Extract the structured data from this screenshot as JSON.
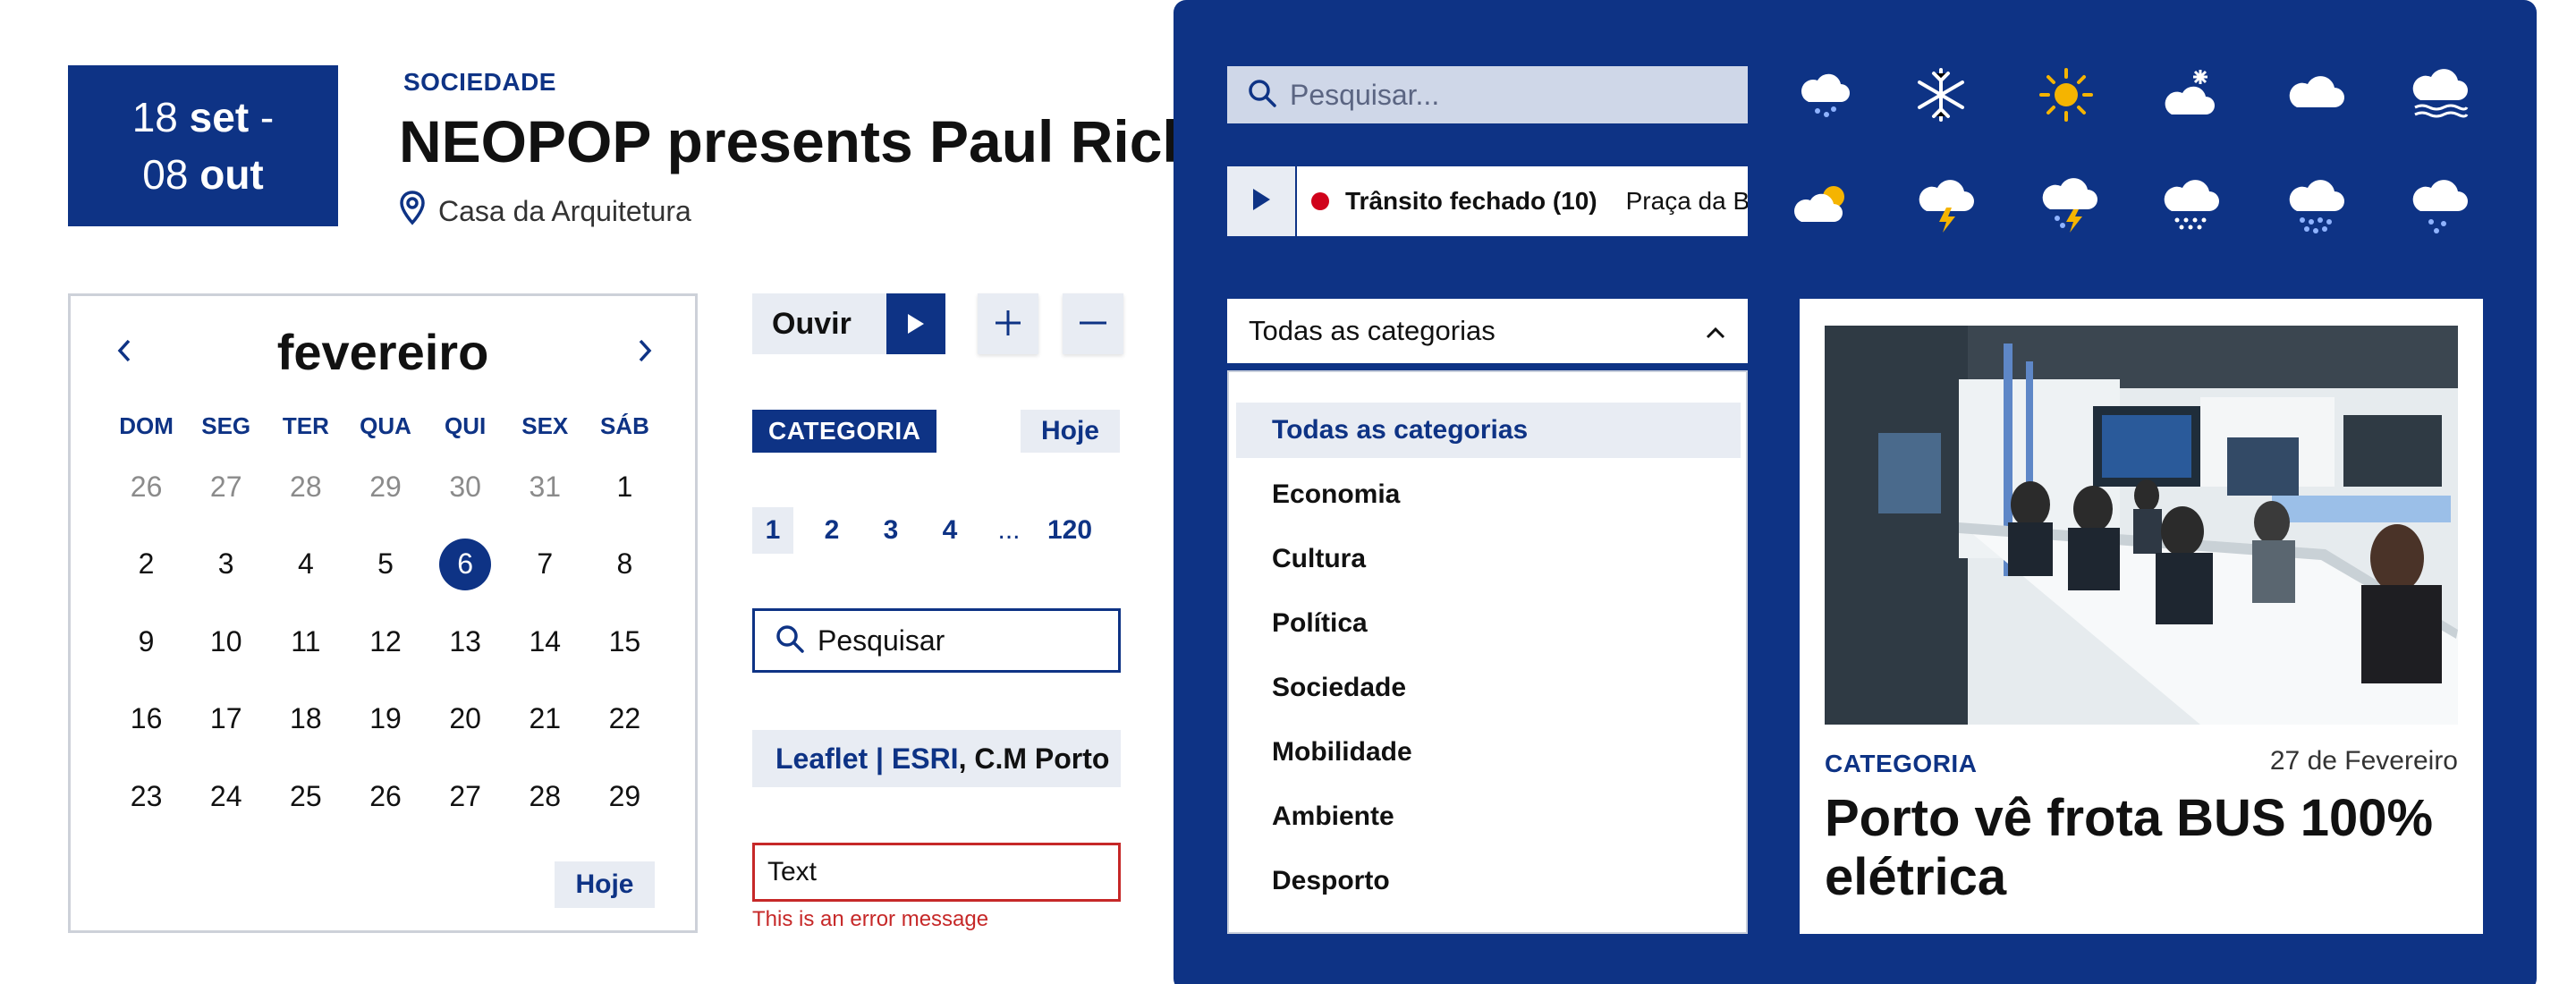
{
  "event": {
    "date_start_day": "18",
    "date_start_month": "set",
    "date_separator": " -",
    "date_end_day": "08",
    "date_end_month": "out",
    "category": "SOCIEDADE",
    "title": "NEOPOP presents Paul Rich",
    "location": "Casa da Arquitetura"
  },
  "calendar": {
    "month": "fevereiro",
    "prev_icon": "chevron-left-icon",
    "next_icon": "chevron-right-icon",
    "weekdays": [
      "DOM",
      "SEG",
      "TER",
      "QUA",
      "QUI",
      "SEX",
      "SÁB"
    ],
    "weeks": [
      [
        "26",
        "27",
        "28",
        "29",
        "30",
        "31",
        "1"
      ],
      [
        "2",
        "3",
        "4",
        "5",
        "6",
        "7",
        "8"
      ],
      [
        "9",
        "10",
        "11",
        "12",
        "13",
        "14",
        "15"
      ],
      [
        "16",
        "17",
        "18",
        "19",
        "20",
        "21",
        "22"
      ],
      [
        "23",
        "24",
        "25",
        "26",
        "27",
        "28",
        "29"
      ]
    ],
    "selected_day": "6",
    "today_label": "Hoje"
  },
  "controls": {
    "listen_label": "Ouvir",
    "zoom_in_icon": "plus-icon",
    "zoom_out_icon": "minus-icon",
    "category_tag": "CATEGORIA",
    "today_label": "Hoje",
    "pagination": [
      "1",
      "2",
      "3",
      "4",
      "...",
      "120"
    ],
    "current_page": "1",
    "search_value": "Pesquisar",
    "attribution_link": "Leaflet | ESRI",
    "attribution_rest": ", C.M Porto",
    "error_input_value": "Text",
    "error_message": "This is an error message"
  },
  "panel": {
    "search_placeholder": "Pesquisar...",
    "ticker_title": "Trânsito fechado (10)",
    "ticker_location": "Praça da Batalha",
    "weather_icons": [
      "light-rain-cloud-icon",
      "snowflake-icon",
      "sun-icon",
      "snow-cloud-icon",
      "cloud-icon",
      "fog-cloud-icon",
      "partly-cloudy-icon",
      "thunderstorm-icon",
      "rain-thunder-icon",
      "drizzle-cloud-icon",
      "rain-cloud-icon",
      "showers-cloud-icon"
    ],
    "accent_color": "#0e3385",
    "select_value": "Todas as categorias",
    "categories": [
      "Todas as categorias",
      "Economia",
      "Cultura",
      "Política",
      "Sociedade",
      "Mobilidade",
      "Ambiente",
      "Desporto"
    ]
  },
  "news_card": {
    "category": "CATEGORIA",
    "date": "27 de Fevereiro",
    "title": "Porto vê frota BUS 100% elétrica"
  }
}
